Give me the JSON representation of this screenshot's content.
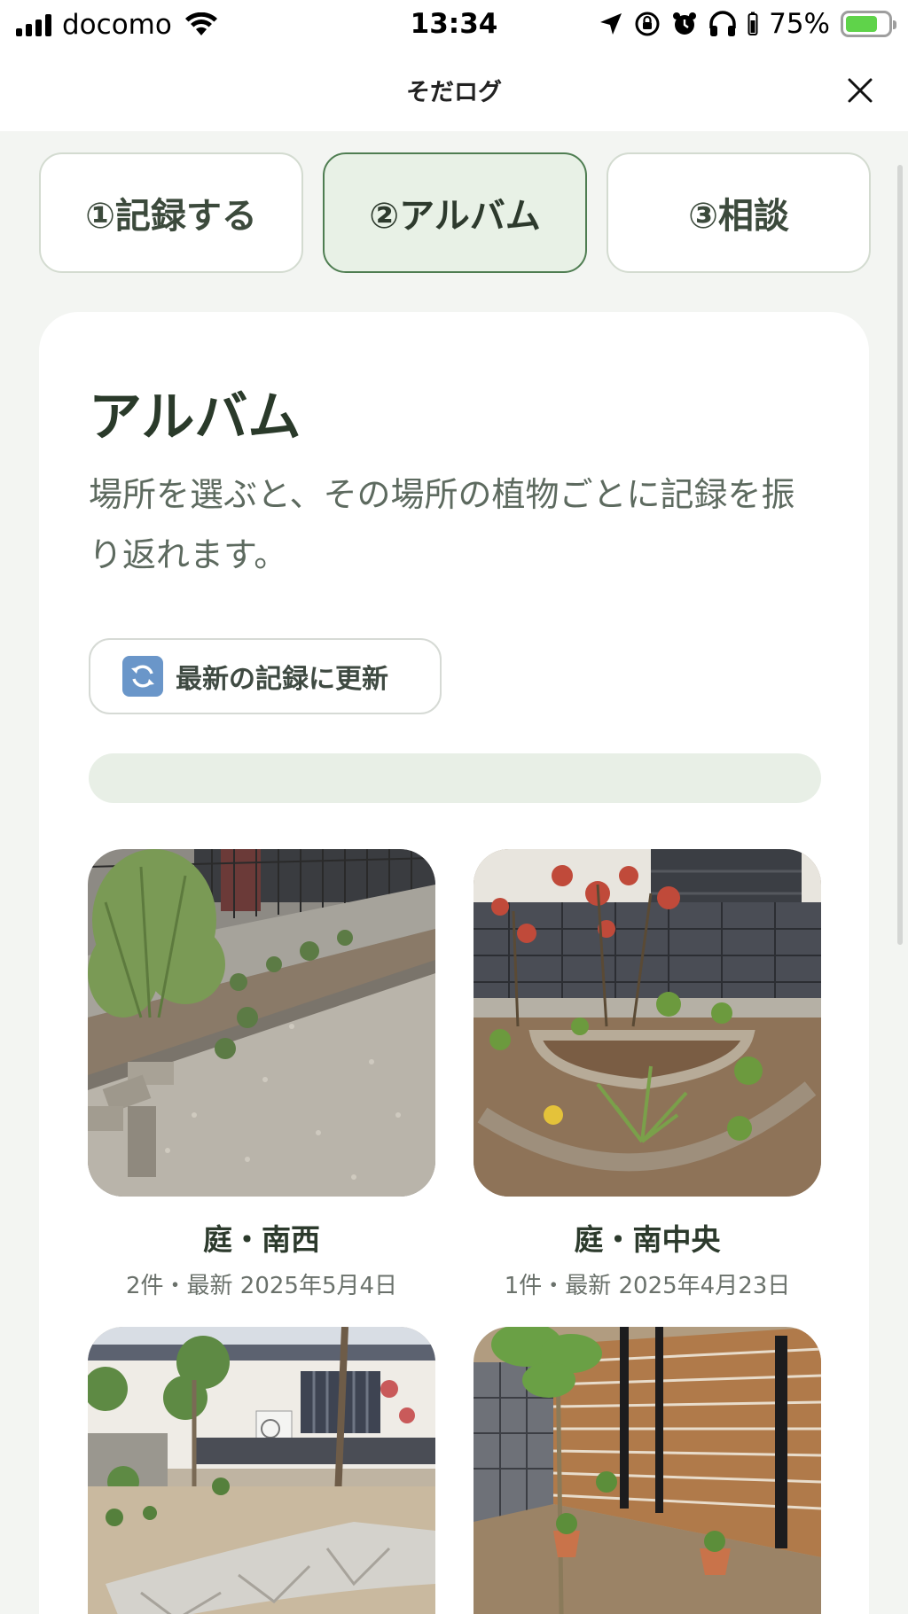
{
  "status_bar": {
    "carrier": "docomo",
    "time": "13:34",
    "battery_percent": "75%",
    "battery_level": 0.75
  },
  "nav": {
    "title": "そだログ"
  },
  "tabs": [
    {
      "label": "①記録する",
      "active": false
    },
    {
      "label": "②アルバム",
      "active": true
    },
    {
      "label": "③相談",
      "active": false
    }
  ],
  "album": {
    "title": "アルバム",
    "description": "場所を選ぶと、その場所の植物ごとに記録を振り返れます。",
    "refresh_label": "最新の記録に更新",
    "progress": 0,
    "items": [
      {
        "name": "庭・南西",
        "meta": "2件・最新 2025年5月4日"
      },
      {
        "name": "庭・南中央",
        "meta": "1件・最新 2025年4月23日"
      },
      {
        "name": "",
        "meta": ""
      },
      {
        "name": "",
        "meta": ""
      }
    ]
  },
  "colors": {
    "accent": "#4e7d51",
    "active_tab_bg": "#e8f1e6",
    "page_bg": "#f3f5f2"
  }
}
